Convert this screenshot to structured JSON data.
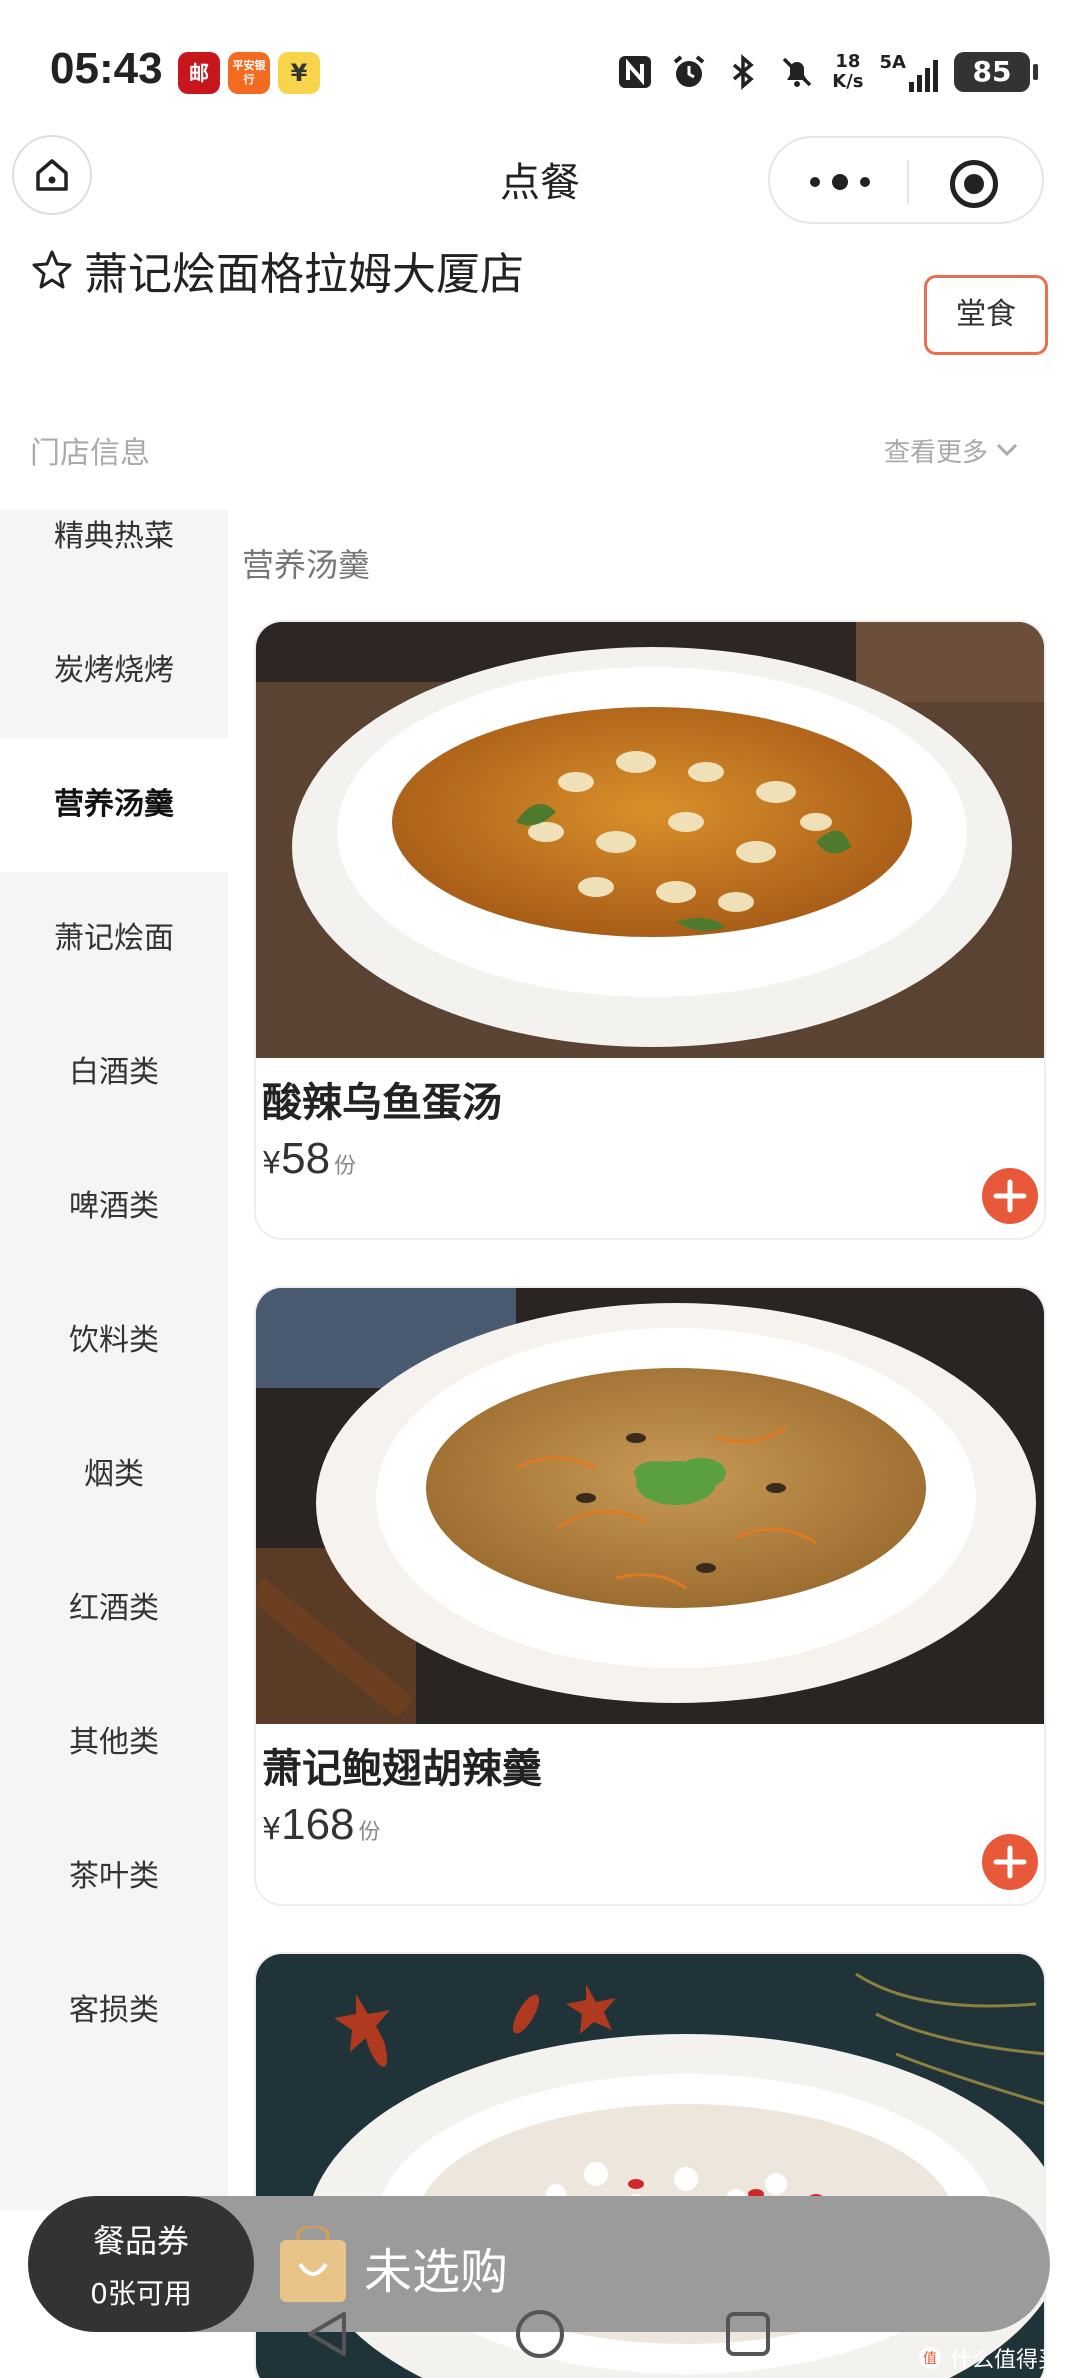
{
  "status_bar": {
    "time": "05:43",
    "app_icon_1": "邮",
    "app_icon_2": "平安银行",
    "app_icon_3": "¥",
    "net_speed_top": "18",
    "net_speed_bottom": "K/s",
    "signal_label": "5A",
    "battery": "85"
  },
  "nav": {
    "title": "点餐"
  },
  "store": {
    "name": "萧记烩面格拉姆大厦店",
    "dine_mode": "堂食",
    "info_label": "门店信息",
    "see_more": "查看更多"
  },
  "sidebar": {
    "items": [
      {
        "label": "精典热菜"
      },
      {
        "label": "炭烤烧烤"
      },
      {
        "label": "营养汤羹"
      },
      {
        "label": "萧记烩面"
      },
      {
        "label": "白酒类"
      },
      {
        "label": "啤酒类"
      },
      {
        "label": "饮料类"
      },
      {
        "label": "烟类"
      },
      {
        "label": "红酒类"
      },
      {
        "label": "其他类"
      },
      {
        "label": "茶叶类"
      },
      {
        "label": "客损类"
      }
    ]
  },
  "menu": {
    "section_title": "营养汤羹",
    "dishes": [
      {
        "name": "酸辣乌鱼蛋汤",
        "currency": "¥",
        "price": "58",
        "unit": "份"
      },
      {
        "name": "萧记鲍翅胡辣羹",
        "currency": "¥",
        "price": "168",
        "unit": "份"
      }
    ]
  },
  "bottom": {
    "coupon_title": "餐品券",
    "coupon_sub": "0张可用",
    "cart_text": "未选购",
    "watermark": "什么值得买"
  },
  "colors": {
    "accent": "#e8593a",
    "sidebar_bg": "#f5f5f5",
    "cart_bar": "#9b9b9b"
  }
}
